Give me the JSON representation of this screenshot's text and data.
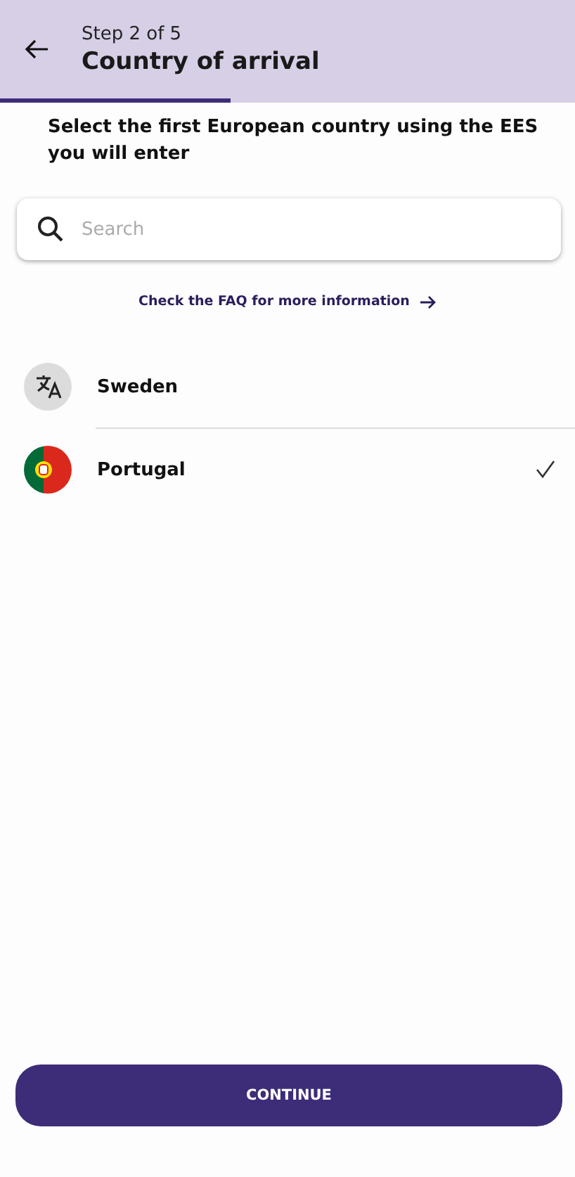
{
  "header": {
    "step": "Step 2 of 5",
    "title": "Country of arrival",
    "progress": {
      "level": 0.4
    }
  },
  "instruction": "Select the first European country using the EES you will enter",
  "search": {
    "placeholder": "Search"
  },
  "faq_link": "Check the FAQ for more information",
  "countries": [
    {
      "name": "Sweden",
      "kind": "translate",
      "selected": false
    },
    {
      "name": "Portugal",
      "kind": "flag",
      "selected": true
    }
  ],
  "continue_button": "CONTINUE"
}
